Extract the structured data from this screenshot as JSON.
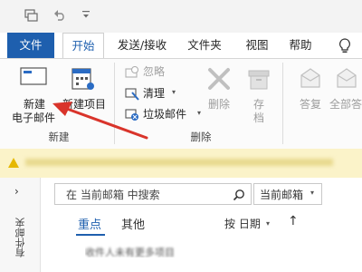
{
  "qat": {
    "icons": [
      "send-receive-icon",
      "undo-icon",
      "customize-dropdown-icon"
    ]
  },
  "tabs": [
    {
      "label": "文件"
    },
    {
      "label": "开始"
    },
    {
      "label": "发送/接收"
    },
    {
      "label": "文件夹"
    },
    {
      "label": "视图"
    },
    {
      "label": "帮助"
    }
  ],
  "ribbon": {
    "new_group": {
      "label": "新建",
      "new_email": {
        "line1": "新建",
        "line2": "电子邮件"
      },
      "new_items": "新建项目"
    },
    "delete_group": {
      "label": "删除",
      "ignore": "忽略",
      "cleanup": "清理",
      "junk": "垃圾邮件",
      "delete": "删除",
      "archive": {
        "line1": "存",
        "line2": "档"
      }
    },
    "respond_group": {
      "reply": "答复",
      "reply_all": "全部答"
    }
  },
  "search": {
    "placeholder": "在 当前邮箱 中搜索",
    "scope": "当前邮箱"
  },
  "filters": {
    "focused": "重点",
    "other": "其他",
    "sort": "按 日期",
    "sort_arrow": "↑"
  },
  "folder_pane_label": "有件邮夹",
  "message_preview": "收件人未有更多项目",
  "colors": {
    "accent": "#1e5fae",
    "annotation_arrow": "#d9342b"
  }
}
